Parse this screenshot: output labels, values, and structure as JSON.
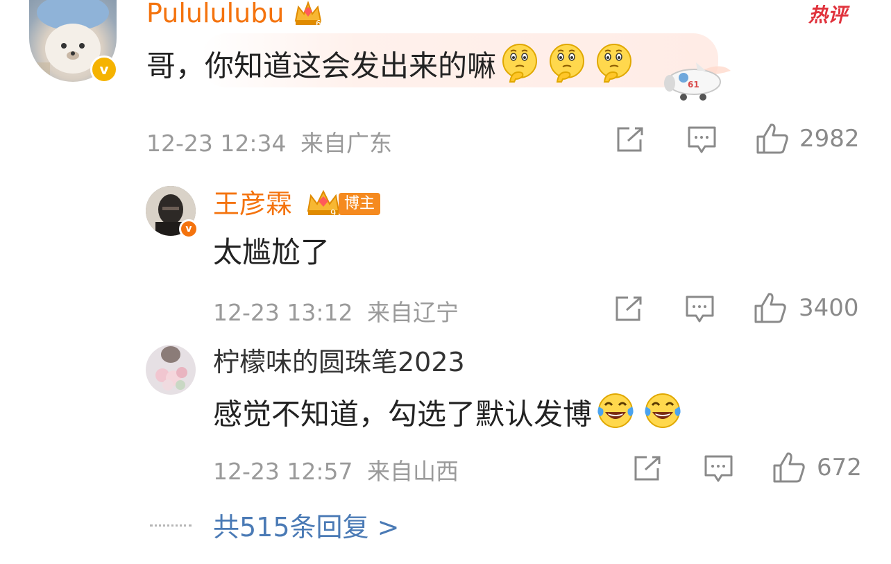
{
  "comments": [
    {
      "username": "Pulululubu",
      "text": "哥，你知道这会发出来的嘛",
      "emoji_count": 3,
      "emoji": "thinking-face-icon",
      "hot_label": "热评",
      "time": "12-23 12:34",
      "location": "来自广东",
      "likes": "2982"
    },
    {
      "username": "王彦霖",
      "badge_label": "博主",
      "text": "太尴尬了",
      "time": "12-23 13:12",
      "location": "来自辽宁",
      "likes": "3400"
    },
    {
      "username": "柠檬味的圆珠笔2023",
      "text": "感觉不知道，勾选了默认发博",
      "emoji_count": 2,
      "emoji": "tears-of-joy-icon",
      "time": "12-23 12:57",
      "location": "来自山西",
      "likes": "672"
    }
  ],
  "more_replies": "共515条回复 >",
  "colors": {
    "username_accent": "#f4730e",
    "meta_gray": "#9a9a9a",
    "link_blue": "#4a7ab5",
    "verify_gold": "#f5b301",
    "verify_orange": "#f4730e",
    "hot_red": "#e0323c"
  }
}
